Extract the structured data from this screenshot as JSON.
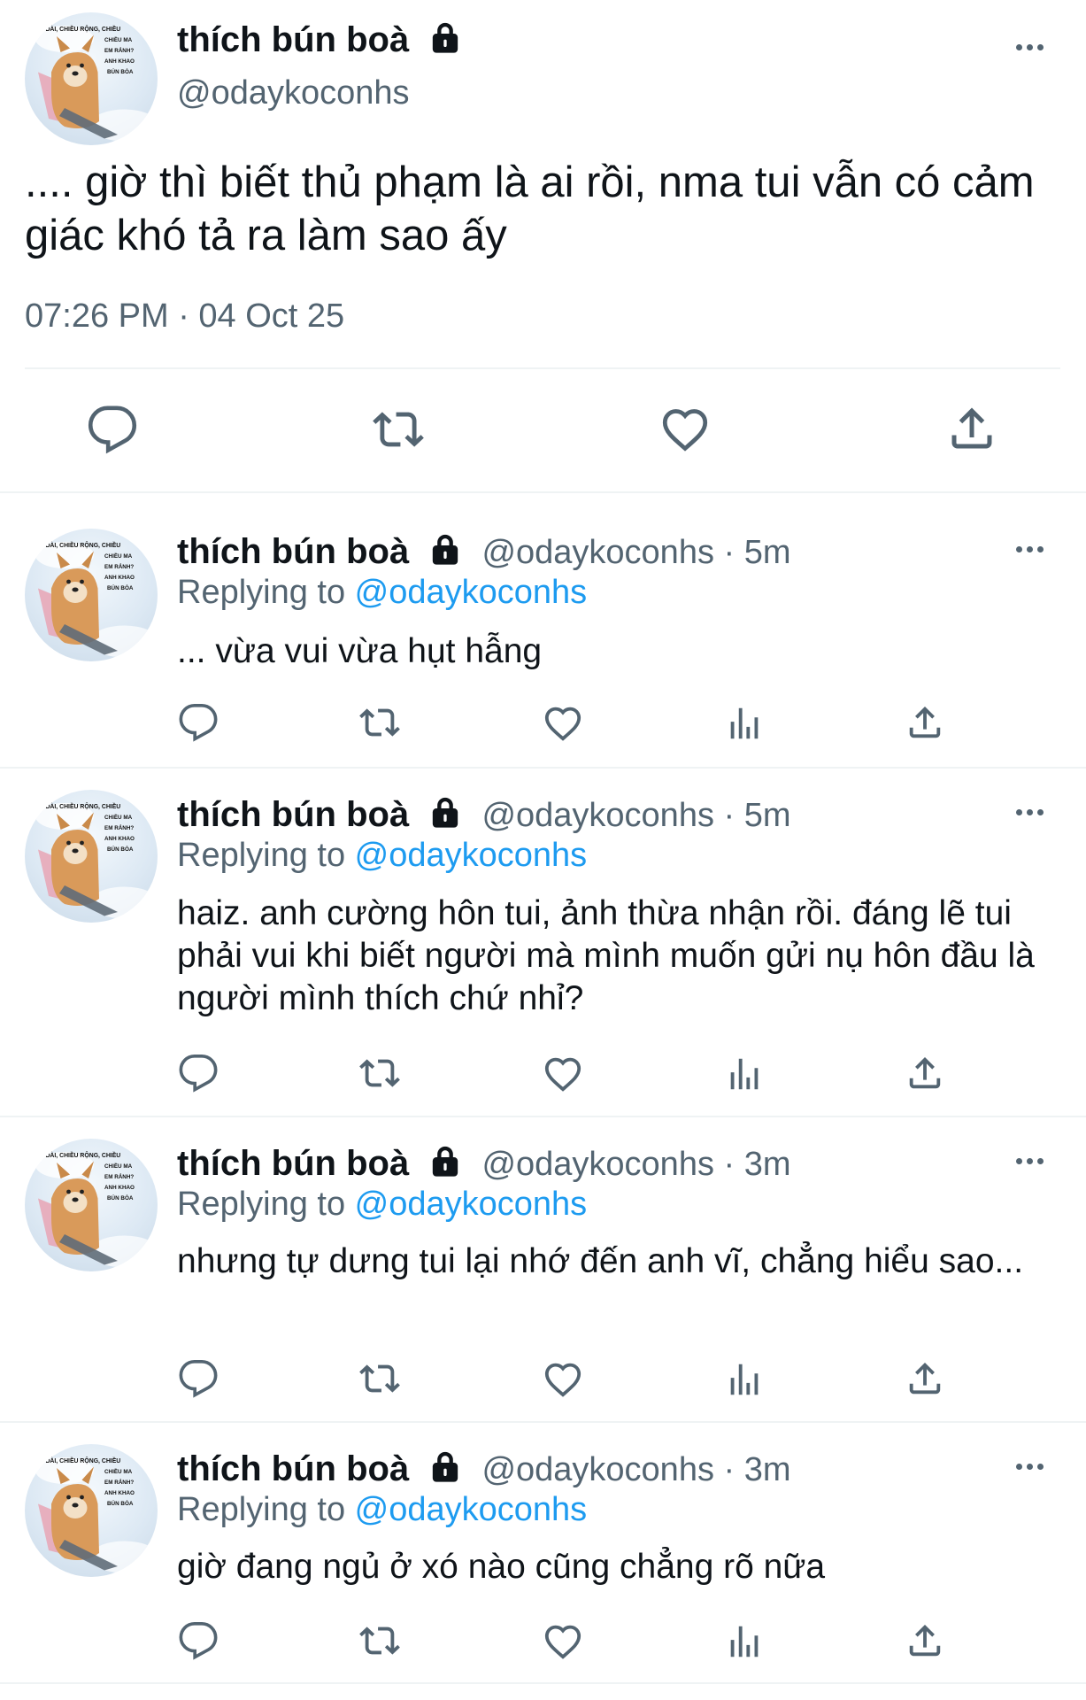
{
  "main_tweet": {
    "display_name": "thích bún boà",
    "handle": "@odaykoconhs",
    "text": ".... giờ thì biết thủ phạm là ai rồi, nma tui vẫn có cảm giác khó tả ra làm sao ấy",
    "timestamp": "07:26 PM · 04 Oct 25",
    "avatar_text": "CHIỀU DÀI, CHIỀU RỘNG, CHIỀU... EM RẢNH? ANH KHAO BÚN BÒA"
  },
  "replies": [
    {
      "display_name": "thích bún boà",
      "meta": "@odaykoconhs · 5m",
      "replying_prefix": "Replying to ",
      "replying_handle": "@odaykoconhs",
      "text": "... vừa vui vừa hụt hẫng"
    },
    {
      "display_name": "thích bún boà",
      "meta": "@odaykoconhs · 5m",
      "replying_prefix": "Replying to ",
      "replying_handle": "@odaykoconhs",
      "text": "haiz. anh cường hôn tui, ảnh thừa nhận rồi. đáng lẽ tui phải vui khi biết người mà mình muốn gửi nụ hôn đầu là người mình thích chứ nhỉ?"
    },
    {
      "display_name": "thích bún boà",
      "meta": "@odaykoconhs · 3m",
      "replying_prefix": "Replying to ",
      "replying_handle": "@odaykoconhs",
      "text": "nhưng tự dưng tui lại nhớ đến anh vĩ, chẳng hiểu sao..."
    },
    {
      "display_name": "thích bún boà",
      "meta": "@odaykoconhs · 3m",
      "replying_prefix": "Replying to ",
      "replying_handle": "@odaykoconhs",
      "text": "giờ đang ngủ ở xó nào cũng chẳng rõ nữa"
    }
  ],
  "icons": {
    "reply": "reply-icon",
    "retweet": "retweet-icon",
    "like": "heart-icon",
    "views": "analytics-icon",
    "share": "share-icon",
    "more": "more-icon",
    "lock": "lock-icon"
  },
  "colors": {
    "link": "#1d9bf0",
    "muted": "#536471",
    "text": "#0f1419",
    "divider": "#eff3f4"
  }
}
